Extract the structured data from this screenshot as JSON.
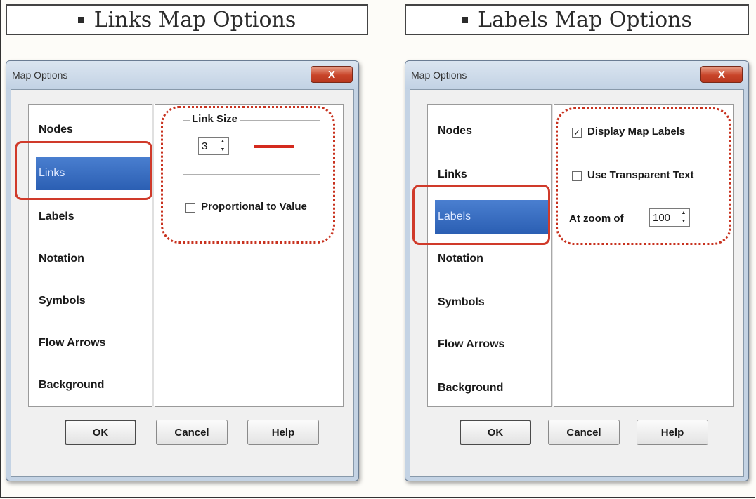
{
  "left": {
    "heading": "Links Map Options",
    "dialog_title": "Map Options",
    "close_label": "X",
    "sidebar": [
      "Nodes",
      "Links",
      "Labels",
      "Notation",
      "Symbols",
      "Flow Arrows",
      "Background"
    ],
    "selected": "Links",
    "link_size_label": "Link Size",
    "link_size_value": "3",
    "proportional_label": "Proportional to Value",
    "proportional_checked": false,
    "buttons": {
      "ok": "OK",
      "cancel": "Cancel",
      "help": "Help"
    }
  },
  "right": {
    "heading": "Labels Map Options",
    "dialog_title": "Map Options",
    "close_label": "X",
    "sidebar": [
      "Nodes",
      "Links",
      "Labels",
      "Notation",
      "Symbols",
      "Flow Arrows",
      "Background"
    ],
    "selected": "Labels",
    "display_labels_label": "Display Map Labels",
    "display_labels_checked": true,
    "transparent_label": "Use Transparent Text",
    "transparent_checked": false,
    "zoom_label": "At zoom of",
    "zoom_value": "100",
    "buttons": {
      "ok": "OK",
      "cancel": "Cancel",
      "help": "Help"
    }
  },
  "colors": {
    "highlight": "#d03a2a",
    "selected_item": "#2b5fb3",
    "link_line": "#d42a1e"
  }
}
